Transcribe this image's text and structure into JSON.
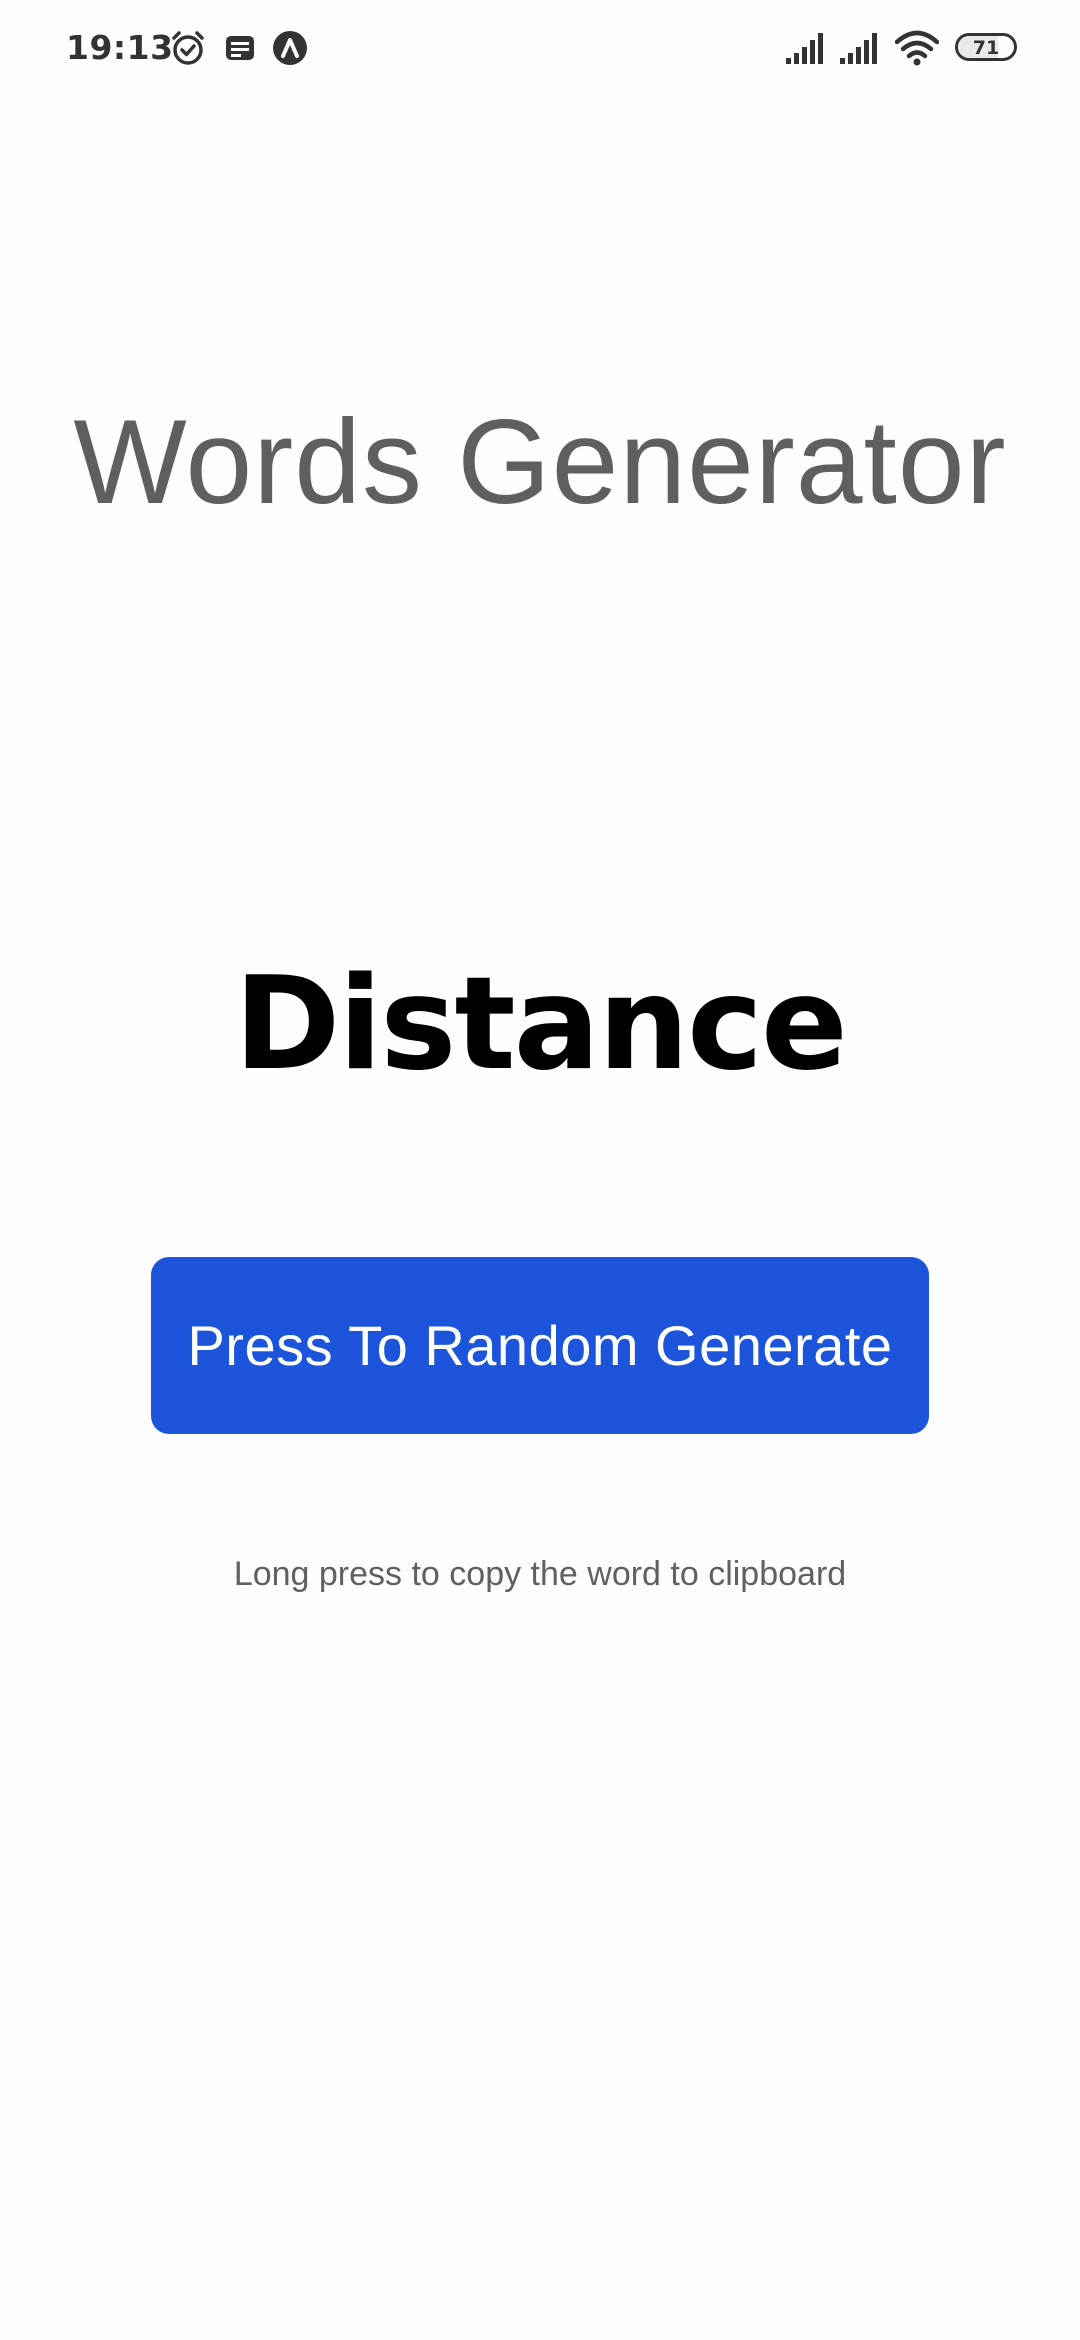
{
  "status_bar": {
    "time": "19:13",
    "icons": [
      "alarm-icon",
      "notes-icon",
      "app-notification-icon",
      "signal-icon",
      "signal-icon",
      "wifi-icon",
      "battery-icon"
    ],
    "battery_level": "71",
    "battery_fraction": 0.71
  },
  "main": {
    "title": "Words Generator",
    "word": "Distance",
    "generate_button_label": "Press To Random Generate",
    "hint": "Long press to copy the word to clipboard"
  },
  "colors": {
    "background": "#fdfdfd",
    "title": "#5f5f5f",
    "word": "#000000",
    "button_bg": "#1c55db",
    "button_text": "#ffffff",
    "hint": "#606060"
  }
}
